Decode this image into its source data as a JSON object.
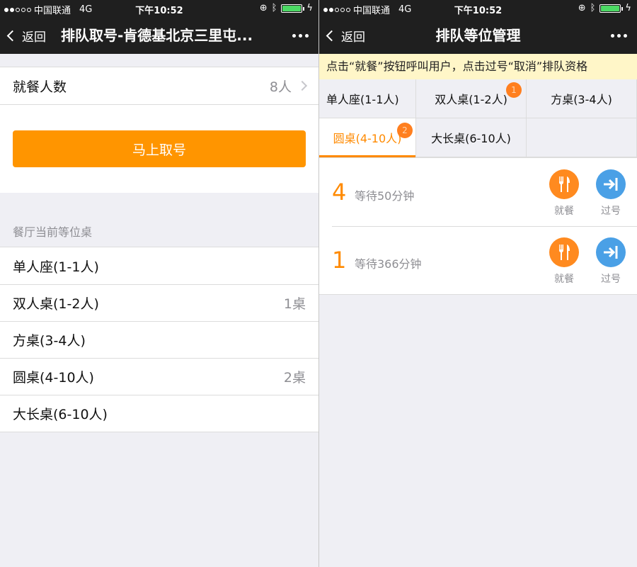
{
  "status_bar": {
    "carrier": "中国联通",
    "network": "4G",
    "time": "下午10:52"
  },
  "left": {
    "nav": {
      "back_label": "返回",
      "title": "排队取号-肯德基北京三里屯..."
    },
    "diners": {
      "label": "就餐人数",
      "value": "8人"
    },
    "take_number_button": "马上取号",
    "section_header": "餐厅当前等位桌",
    "tables": [
      {
        "name": "单人座(1-1人)",
        "count": ""
      },
      {
        "name": "双人桌(1-2人)",
        "count": "1桌"
      },
      {
        "name": "方桌(3-4人)",
        "count": ""
      },
      {
        "name": "圆桌(4-10人)",
        "count": "2桌"
      },
      {
        "name": "大长桌(6-10人)",
        "count": ""
      }
    ]
  },
  "right": {
    "nav": {
      "back_label": "返回",
      "title": "排队等位管理"
    },
    "notice": "点击“就餐”按钮呼叫用户，点击过号“取消”排队资格",
    "tabs": [
      {
        "label": "单人座(1-1人)",
        "badge": ""
      },
      {
        "label": "双人桌(1-2人)",
        "badge": "1"
      },
      {
        "label": "方桌(3-4人)",
        "badge": ""
      },
      {
        "label": "圆桌(4-10人)",
        "badge": "2",
        "active": true
      },
      {
        "label": "大长桌(6-10人)",
        "badge": ""
      }
    ],
    "queue": [
      {
        "number": "4",
        "wait": "等待50分钟"
      },
      {
        "number": "1",
        "wait": "等待366分钟"
      }
    ],
    "actions": {
      "dine": "就餐",
      "skip": "过号"
    }
  },
  "colors": {
    "accent": "#ff9500",
    "tab_active": "#ff8a00",
    "blue": "#4aa0e6",
    "notice_bg": "#fff6c8"
  }
}
